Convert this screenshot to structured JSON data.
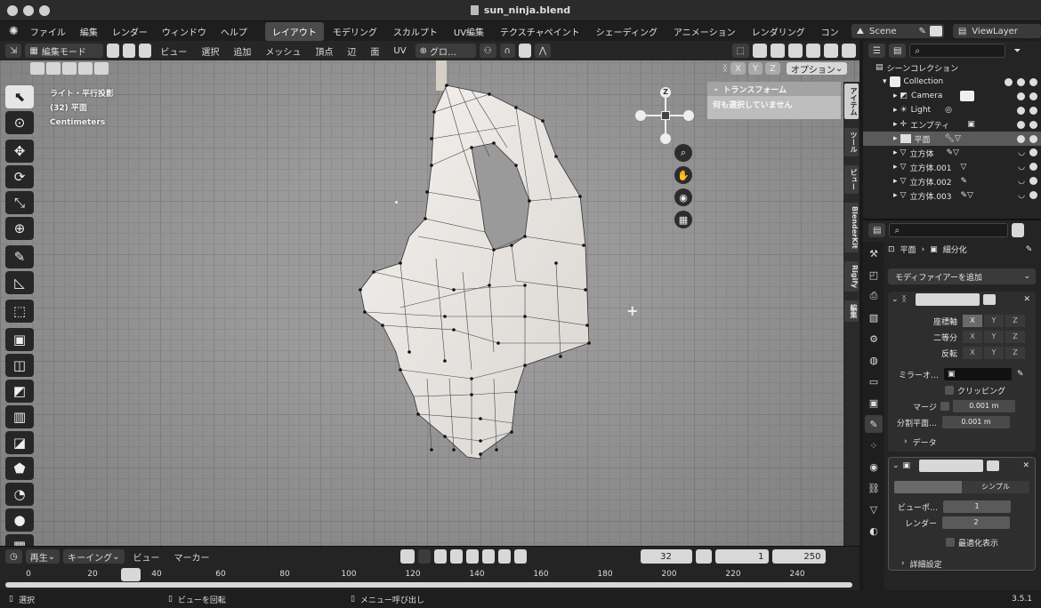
{
  "window": {
    "title": "sun_ninja.blend"
  },
  "topbar": {
    "menus": [
      "ファイル",
      "編集",
      "レンダー",
      "ウィンドウ",
      "ヘルプ"
    ],
    "workspaces": [
      "レイアウト",
      "モデリング",
      "スカルプト",
      "UV編集",
      "テクスチャペイント",
      "シェーディング",
      "アニメーション",
      "レンダリング",
      "コン"
    ],
    "active_workspace": "レイアウト",
    "scene": "Scene",
    "view_layer": "ViewLayer"
  },
  "viewport_header": {
    "mode": "編集モード",
    "menus": [
      "ビュー",
      "選択",
      "追加",
      "メッシュ",
      "頂点",
      "辺",
      "面",
      "UV"
    ],
    "transform": "グロ…",
    "options": "オプション"
  },
  "viewport_info": {
    "line1": "ライト・平行投影",
    "line2": "(32) 平面",
    "line3": "Centimeters"
  },
  "npanel": {
    "header": "トランスフォーム",
    "body": "何も選択していません",
    "tabs": [
      "アイテム",
      "ツール",
      "ビュー",
      "BlenderKit",
      "Rigify",
      "編集"
    ],
    "active_tab": "アイテム"
  },
  "gizmo": {
    "z": "Z"
  },
  "outliner": {
    "title": "シーンコレクション",
    "items": [
      {
        "label": "Collection"
      },
      {
        "label": "Camera"
      },
      {
        "label": "Light"
      },
      {
        "label": "エンプティ"
      },
      {
        "label": "平面"
      },
      {
        "label": "立方体"
      },
      {
        "label": "立方体.001"
      },
      {
        "label": "立方体.002"
      },
      {
        "label": "立方体.003"
      }
    ]
  },
  "properties": {
    "breadcrumb_obj": "平面",
    "breadcrumb_mod": "細分化",
    "add_modifier": "モディファイアーを追加",
    "mirror": {
      "axis_label": "座標軸",
      "bisect_label": "二等分",
      "flip_label": "反転",
      "xyz": [
        "X",
        "Y",
        "Z"
      ],
      "mirror_obj_label": "ミラーオ…",
      "clipping_label": "クリッピング",
      "merge_label": "マージ",
      "merge_value": "0.001 m",
      "bisect_dist_label": "分割平面…",
      "bisect_dist_value": "0.001 m",
      "data_label": "データ"
    },
    "subdiv": {
      "tab_simple": "シンプル",
      "viewport_label": "ビューポ…",
      "viewport_value": "1",
      "render_label": "レンダー",
      "render_value": "2",
      "optimal_label": "最適化表示",
      "advanced_label": "詳細設定"
    }
  },
  "timeline": {
    "playback": "再生",
    "keying": "キーイング",
    "view": "ビュー",
    "marker": "マーカー",
    "current_frame": "32",
    "start": "1",
    "end": "250",
    "ticks": [
      "0",
      "20",
      "40",
      "60",
      "80",
      "100",
      "120",
      "140",
      "160",
      "180",
      "200",
      "220",
      "240"
    ]
  },
  "statusbar": {
    "select": "選択",
    "rotate": "ビューを回転",
    "menu": "メニュー呼び出し",
    "version": "3.5.1"
  }
}
